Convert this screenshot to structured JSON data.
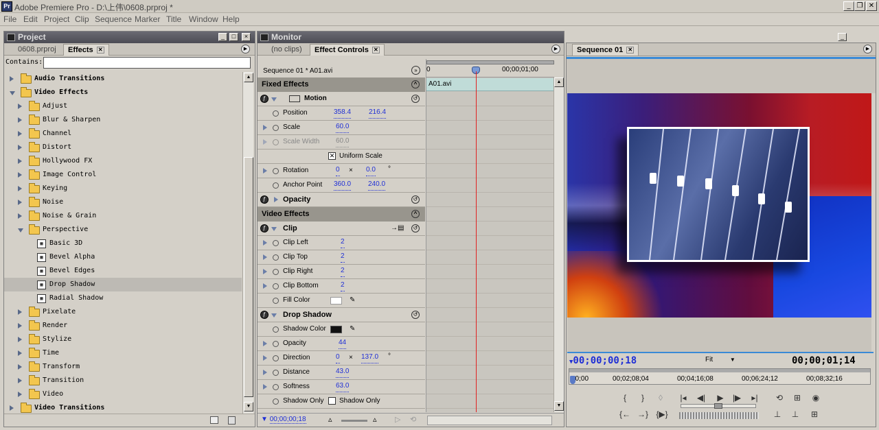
{
  "app": {
    "title": "Adobe Premiere Pro - D:\\上伟\\0608.prproj *"
  },
  "menu": [
    "File",
    "Edit",
    "Project",
    "Clip",
    "Sequence",
    "Marker",
    "Title",
    "Window",
    "Help"
  ],
  "project_panel": {
    "title": "Project",
    "tabs": [
      "0608.prproj",
      "Effects"
    ],
    "contains_label": "Contains:",
    "contains_value": "",
    "tree": [
      {
        "label": "Audio Transitions",
        "expanded": false,
        "bold": true,
        "type": "folder",
        "level": 0
      },
      {
        "label": "Video Effects",
        "expanded": true,
        "bold": true,
        "type": "folder",
        "level": 0
      },
      {
        "label": "Adjust",
        "expanded": false,
        "type": "folder",
        "level": 1
      },
      {
        "label": "Blur & Sharpen",
        "expanded": false,
        "type": "folder",
        "level": 1
      },
      {
        "label": "Channel",
        "expanded": false,
        "type": "folder",
        "level": 1
      },
      {
        "label": "Distort",
        "expanded": false,
        "type": "folder",
        "level": 1
      },
      {
        "label": "Hollywood FX",
        "expanded": false,
        "type": "folder",
        "level": 1
      },
      {
        "label": "Image Control",
        "expanded": false,
        "type": "folder",
        "level": 1
      },
      {
        "label": "Keying",
        "expanded": false,
        "type": "folder",
        "level": 1
      },
      {
        "label": "Noise",
        "expanded": false,
        "type": "folder",
        "level": 1
      },
      {
        "label": "Noise & Grain",
        "expanded": false,
        "type": "folder",
        "level": 1
      },
      {
        "label": "Perspective",
        "expanded": true,
        "type": "folder",
        "level": 1
      },
      {
        "label": "Basic 3D",
        "type": "effect",
        "level": 2
      },
      {
        "label": "Bevel Alpha",
        "type": "effect",
        "level": 2
      },
      {
        "label": "Bevel Edges",
        "type": "effect",
        "level": 2
      },
      {
        "label": "Drop Shadow",
        "type": "effect",
        "level": 2,
        "selected": true
      },
      {
        "label": "Radial Shadow",
        "type": "effect",
        "level": 2
      },
      {
        "label": "Pixelate",
        "expanded": false,
        "type": "folder",
        "level": 1
      },
      {
        "label": "Render",
        "expanded": false,
        "type": "folder",
        "level": 1
      },
      {
        "label": "Stylize",
        "expanded": false,
        "type": "folder",
        "level": 1
      },
      {
        "label": "Time",
        "expanded": false,
        "type": "folder",
        "level": 1
      },
      {
        "label": "Transform",
        "expanded": false,
        "type": "folder",
        "level": 1
      },
      {
        "label": "Transition",
        "expanded": false,
        "type": "folder",
        "level": 1
      },
      {
        "label": "Video",
        "expanded": false,
        "type": "folder",
        "level": 1
      },
      {
        "label": "Video Transitions",
        "expanded": false,
        "bold": true,
        "type": "folder",
        "level": 0
      }
    ]
  },
  "monitor_panel": {
    "title": "Monitor",
    "tabs": [
      "(no clips)",
      "Effect Controls"
    ],
    "sequence_label": "Sequence 01 * A01.avi",
    "ruler_start": "0",
    "ruler_end": "00;00;01;00",
    "clip_name": "A01.avi",
    "fixed_effects_label": "Fixed Effects",
    "video_effects_label": "Video Effects",
    "motion": {
      "label": "Motion",
      "position_label": "Position",
      "position_x": "358.4",
      "position_y": "216.4",
      "scale_label": "Scale",
      "scale": "60.0",
      "scale_width_label": "Scale Width",
      "scale_width": "60.0",
      "uniform_label": "Uniform Scale",
      "rotation_label": "Rotation",
      "rotation_a": "0",
      "rotation_x": "×",
      "rotation_b": "0.0",
      "rotation_deg": "°",
      "anchor_label": "Anchor Point",
      "anchor_x": "360.0",
      "anchor_y": "240.0"
    },
    "opacity_label": "Opacity",
    "clip": {
      "label": "Clip",
      "left_label": "Clip Left",
      "left": "2",
      "top_label": "Clip Top",
      "top": "2",
      "right_label": "Clip Right",
      "right": "2",
      "bottom_label": "Clip Bottom",
      "bottom": "2",
      "fill_label": "Fill Color"
    },
    "drop_shadow": {
      "label": "Drop Shadow",
      "color_label": "Shadow Color",
      "opacity_label": "Opacity",
      "opacity": "44",
      "direction_label": "Direction",
      "direction_a": "0",
      "direction_x": "×",
      "direction_b": "137.0",
      "direction_deg": "°",
      "distance_label": "Distance",
      "distance": "43.0",
      "softness_label": "Softness",
      "softness": "63.0",
      "only_label": "Shadow Only",
      "only_check_label": "Shadow Only"
    },
    "timecode": "00;00;00;18"
  },
  "program_panel": {
    "tab": "Sequence 01",
    "timecode_current": "00;00;00;18",
    "fit_label": "Fit",
    "timecode_duration": "00;00;01;14",
    "ruler_ticks": [
      "00;00",
      "00;02;08;04",
      "00;04;16;08",
      "00;06;24;12",
      "00;08;32;16"
    ]
  },
  "colors": {
    "accent": "#1f2fd6",
    "playhead": "#e02020",
    "clip_bar": "#c0dcd8"
  }
}
